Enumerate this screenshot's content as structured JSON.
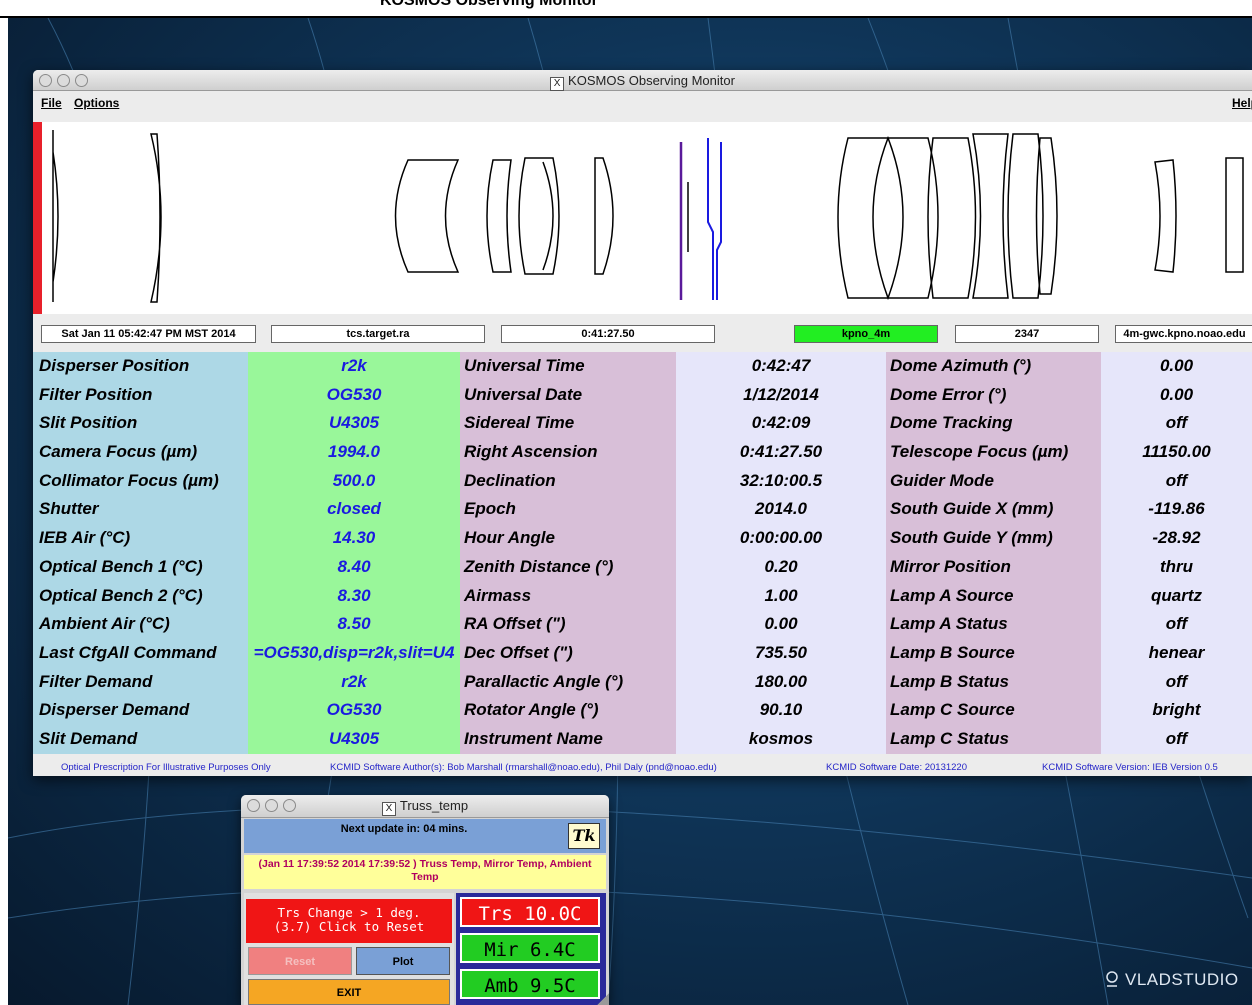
{
  "top_caption": "KOSMOS Observing Monitor",
  "main_window": {
    "title": "KOSMOS Observing Monitor",
    "menu": {
      "file": "File",
      "options": "Options",
      "help": "Help"
    },
    "status": {
      "datetime": "Sat Jan 11 05:42:47 PM MST 2014",
      "target": "tcs.target.ra",
      "ra_value": "0:41:27.50",
      "telescope": "kpno_4m",
      "count": "2347",
      "host": "4m-gwc.kpno.noao.edu"
    },
    "rows": [
      [
        "Disperser Position",
        "r2k",
        "Universal Time",
        "0:42:47",
        "Dome Azimuth (°)",
        "0.00"
      ],
      [
        "Filter Position",
        "OG530",
        "Universal Date",
        "1/12/2014",
        "Dome Error (°)",
        "0.00"
      ],
      [
        "Slit Position",
        "U4305",
        "Sidereal Time",
        "0:42:09",
        "Dome Tracking",
        "off"
      ],
      [
        "Camera Focus (µm)",
        "1994.0",
        "Right Ascension",
        "0:41:27.50",
        "Telescope Focus (µm)",
        "11150.00"
      ],
      [
        "Collimator Focus (µm)",
        "500.0",
        "Declination",
        "32:10:00.5",
        "Guider Mode",
        "off"
      ],
      [
        "Shutter",
        "closed",
        "Epoch",
        "2014.0",
        "South Guide X (mm)",
        "-119.86"
      ],
      [
        "IEB Air (°C)",
        "14.30",
        "Hour Angle",
        "0:00:00.00",
        "South Guide Y (mm)",
        "-28.92"
      ],
      [
        "Optical Bench 1 (°C)",
        "8.40",
        "Zenith Distance (°)",
        "0.20",
        "Mirror Position",
        "thru"
      ],
      [
        "Optical Bench 2 (°C)",
        "8.30",
        "Airmass",
        "1.00",
        "Lamp A Source",
        "quartz"
      ],
      [
        "Ambient Air (°C)",
        "8.50",
        "RA Offset (\")",
        "0.00",
        "Lamp A Status",
        "off"
      ],
      [
        "Last CfgAll Command",
        "=OG530,disp=r2k,slit=U4",
        "Dec Offset (\")",
        "735.50",
        "Lamp B Source",
        "henear"
      ],
      [
        "Filter Demand",
        "r2k",
        "Parallactic Angle (°)",
        "180.00",
        "Lamp B Status",
        "off"
      ],
      [
        "Disperser Demand",
        "OG530",
        "Rotator Angle (°)",
        "90.10",
        "Lamp C Source",
        "bright"
      ],
      [
        "Slit Demand",
        "U4305",
        "Instrument Name",
        "kosmos",
        "Lamp C Status",
        "off"
      ]
    ],
    "footer": {
      "optical": "Optical Prescription For Illustrative Purposes Only",
      "author": "KCMID Software Author(s): Bob Marshall (rmarshall@noao.edu), Phil Daly (pnd@noao.edu)",
      "date": "KCMID Software Date: 20131220",
      "version": "KCMID Software Version: IEB Version 0.5"
    },
    "colors": {
      "label": "#add8e6",
      "value": "#99f79a",
      "status_ok": "#22cc22",
      "alert": "#e8202a"
    }
  },
  "truss_window": {
    "title": "Truss_temp",
    "next_update": "Next update in: 04 mins.",
    "tk_icon": "Tk",
    "message": "(Jan 11 17:39:52 2014 17:39:52 ) Truss Temp, Mirror Temp, Ambient Temp",
    "warning_line1": "Trs Change > 1 deg.",
    "warning_line2": "(3.7) Click to Reset",
    "reset": "Reset",
    "plot": "Plot",
    "exit": "EXIT",
    "trs": "Trs 10.0C",
    "mir": "Mir  6.4C",
    "amb": "Amb  9.5C"
  },
  "watermark": "VLADSTUDIO"
}
